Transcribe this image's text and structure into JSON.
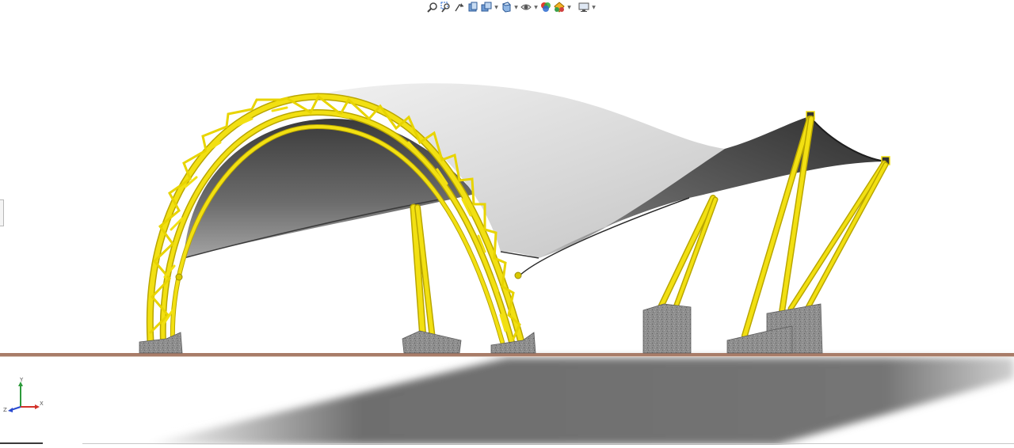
{
  "toolbar": {
    "buttons": [
      {
        "name": "zoom-to-fit-icon",
        "dropdown": false
      },
      {
        "name": "zoom-to-area-icon",
        "dropdown": false
      },
      {
        "name": "previous-view-icon",
        "dropdown": false
      },
      {
        "name": "section-view-icon",
        "dropdown": false
      },
      {
        "name": "view-orientation-icon",
        "dropdown": true
      },
      {
        "name": "display-style-icon",
        "dropdown": true
      },
      {
        "name": "hide-show-items-icon",
        "dropdown": true
      },
      {
        "name": "edit-appearance-icon",
        "dropdown": false
      },
      {
        "name": "apply-scene-icon",
        "dropdown": true
      },
      {
        "name": "view-settings-icon",
        "dropdown": true
      }
    ]
  },
  "triad": {
    "x_label": "X",
    "y_label": "Y",
    "z_label": "Z"
  },
  "colors": {
    "background": "#ffffff",
    "truss": "#f2e012",
    "truss_shadow": "#b9a600",
    "membrane_light": "#e2e2e2",
    "membrane_dark": "#3a3a3a",
    "concrete": "#8c8c8c",
    "floor_edge": "#a87c68",
    "ground_shadow": "#6e6e6e"
  }
}
